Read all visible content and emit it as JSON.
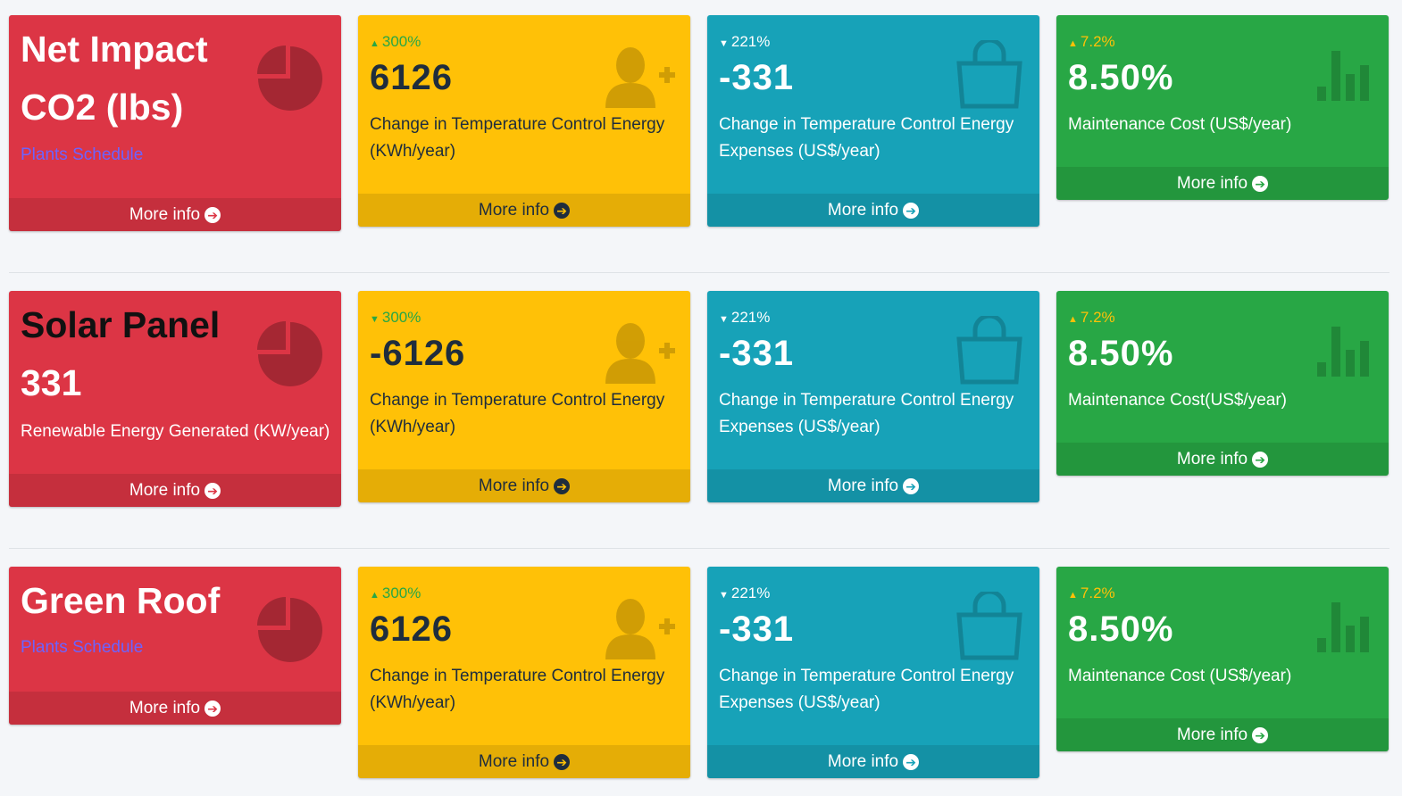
{
  "rows": [
    {
      "red": {
        "title1": "Net Impact",
        "title2": "CO2 (lbs)",
        "link": "Plants Schedule",
        "footer": "More info"
      },
      "yellow": {
        "pct": "300%",
        "value": "6126",
        "label": "Change in Temperature Control Energy (KWh/year)",
        "footer": "More info"
      },
      "teal": {
        "pct": "221%",
        "value": "-331",
        "label": "Change in Temperature Control Energy Expenses (US$/year)",
        "footer": "More info"
      },
      "green": {
        "pct": "7.2%",
        "value": "8.50%",
        "label": "Maintenance Cost (US$/year)",
        "footer": "More info"
      }
    },
    {
      "red": {
        "title1": "Solar Panel",
        "title2": "331",
        "sub": "Renewable Energy Generated (KW/year)",
        "footer": "More info"
      },
      "yellow": {
        "pct": "300%",
        "value": "-6126",
        "label": "Change in Temperature Control Energy (KWh/year)",
        "footer": "More info"
      },
      "teal": {
        "pct": "221%",
        "value": "-331",
        "label": "Change in Temperature Control Energy Expenses (US$/year)",
        "footer": "More info"
      },
      "green": {
        "pct": "7.2%",
        "value": "8.50%",
        "label": "Maintenance Cost(US$/year)",
        "footer": "More info"
      }
    },
    {
      "red": {
        "title1": "Green Roof",
        "link": "Plants Schedule",
        "footer": "More info"
      },
      "yellow": {
        "pct": "300%",
        "value": "6126",
        "label": "Change in Temperature Control Energy (KWh/year)",
        "footer": "More info"
      },
      "teal": {
        "pct": "221%",
        "value": "-331",
        "label": "Change in Temperature Control Energy Expenses (US$/year)",
        "footer": "More info"
      },
      "green": {
        "pct": "7.2%",
        "value": "8.50%",
        "label": "Maintenance Cost (US$/year)",
        "footer": "More info"
      }
    }
  ],
  "icons": {
    "red": "pie-chart-icon",
    "yellow": "user-plus-icon",
    "teal": "shopping-bag-icon",
    "green": "bar-chart-icon",
    "footer": "arrow-circle-right-icon"
  },
  "colors": {
    "danger": "#dc3545",
    "warning": "#ffc107",
    "info": "#17a2b8",
    "success": "#28a745"
  }
}
